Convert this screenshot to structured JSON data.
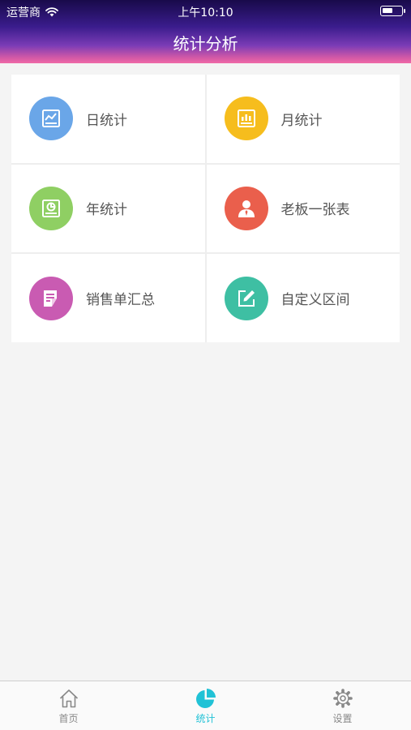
{
  "status_bar": {
    "carrier": "运营商",
    "time": "上午10:10",
    "battery_level": 0.55
  },
  "header": {
    "title": "统计分析"
  },
  "menu": [
    {
      "label": "日统计",
      "icon": "daily-chart-icon",
      "color": "#6aa6e8"
    },
    {
      "label": "月统计",
      "icon": "monthly-chart-icon",
      "color": "#f6bd1d"
    },
    {
      "label": "年统计",
      "icon": "yearly-chart-icon",
      "color": "#8fcf63"
    },
    {
      "label": "老板一张表",
      "icon": "boss-icon",
      "color": "#ea5f4c"
    },
    {
      "label": "销售单汇总",
      "icon": "sales-summary-icon",
      "color": "#c95bb2"
    },
    {
      "label": "自定义区间",
      "icon": "custom-range-icon",
      "color": "#3ebfa3"
    }
  ],
  "tabbar": {
    "active_color": "#21c2d6",
    "items": [
      {
        "label": "首页",
        "icon": "home-icon"
      },
      {
        "label": "统计",
        "icon": "pie-chart-icon"
      },
      {
        "label": "设置",
        "icon": "gear-icon"
      }
    ]
  }
}
